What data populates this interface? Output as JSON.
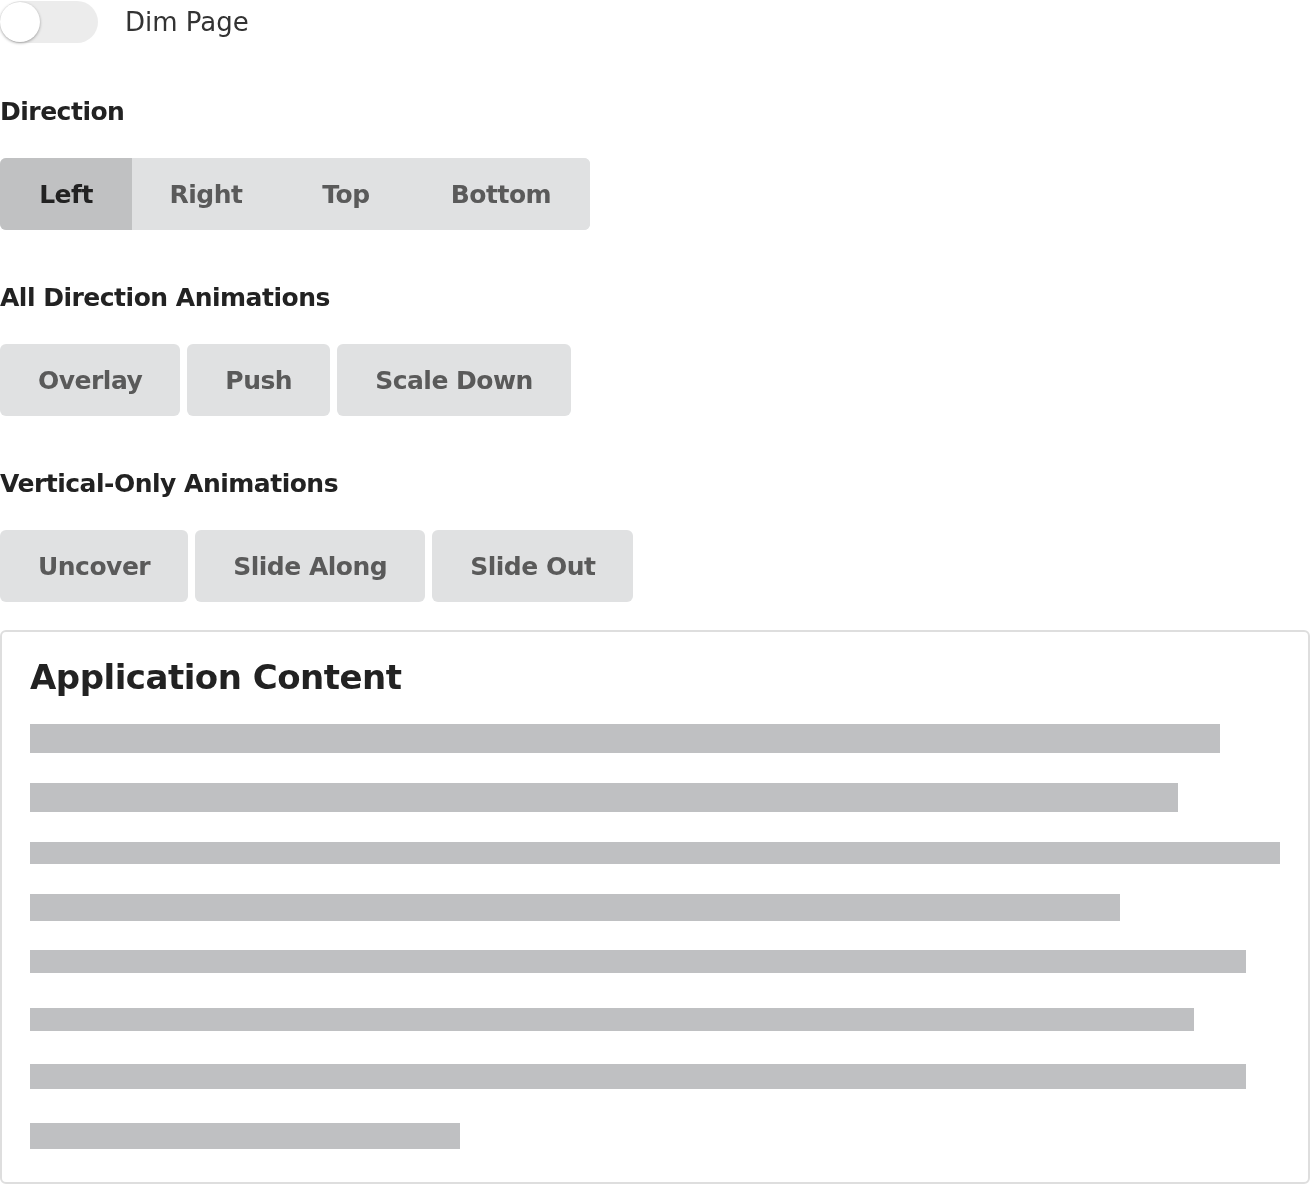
{
  "dim_toggle": {
    "label": "Dim Page",
    "on": false
  },
  "sections": [
    {
      "heading": "Direction",
      "kind": "group",
      "buttons": [
        {
          "label": "Left",
          "selected": true
        },
        {
          "label": "Right",
          "selected": false
        },
        {
          "label": "Top",
          "selected": false
        },
        {
          "label": "Bottom",
          "selected": false
        }
      ]
    },
    {
      "heading": "All Direction Animations",
      "kind": "separate",
      "buttons": [
        {
          "label": "Overlay",
          "selected": false
        },
        {
          "label": "Push",
          "selected": false
        },
        {
          "label": "Scale Down",
          "selected": false
        }
      ]
    },
    {
      "heading": "Vertical-Only Animations",
      "kind": "separate",
      "buttons": [
        {
          "label": "Uncover",
          "selected": false
        },
        {
          "label": "Slide Along",
          "selected": false
        },
        {
          "label": "Slide Out",
          "selected": false
        }
      ]
    }
  ],
  "content": {
    "title": "Application Content"
  }
}
